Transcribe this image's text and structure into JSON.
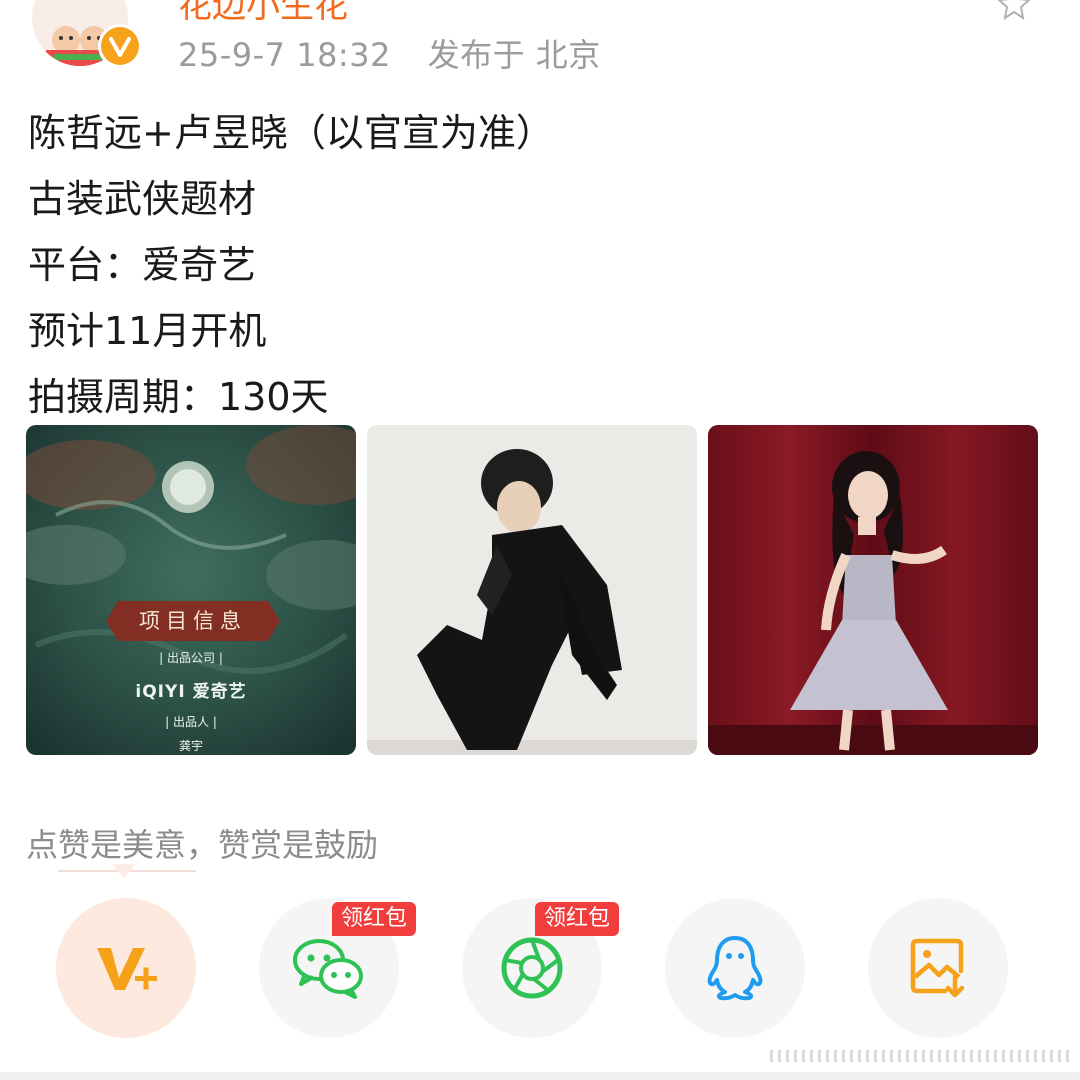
{
  "post": {
    "author_name": "花边小生花",
    "timestamp": "25-9-7 18:32",
    "source": "发布于 北京",
    "lines": [
      "陈哲远+卢昱晓（以官宣为准）",
      "古装武侠题材",
      "平台：爱奇艺",
      "预计11月开机",
      "拍摄周期：130天"
    ]
  },
  "images": {
    "poster": {
      "title": "项目信息",
      "line1": "| 出品公司 |",
      "line2": "iQIYI 爱奇艺",
      "line3": "| 出品人 |",
      "line4": "龚宇"
    }
  },
  "reward": {
    "text": "点赞是美意，赞赏是鼓励"
  },
  "share": {
    "badge1": "领红包",
    "badge2": "领红包"
  },
  "colors": {
    "accent": "#f26b1d",
    "wechat": "#2ec153",
    "qq": "#1e9cf0",
    "badge": "#f23d3d"
  }
}
